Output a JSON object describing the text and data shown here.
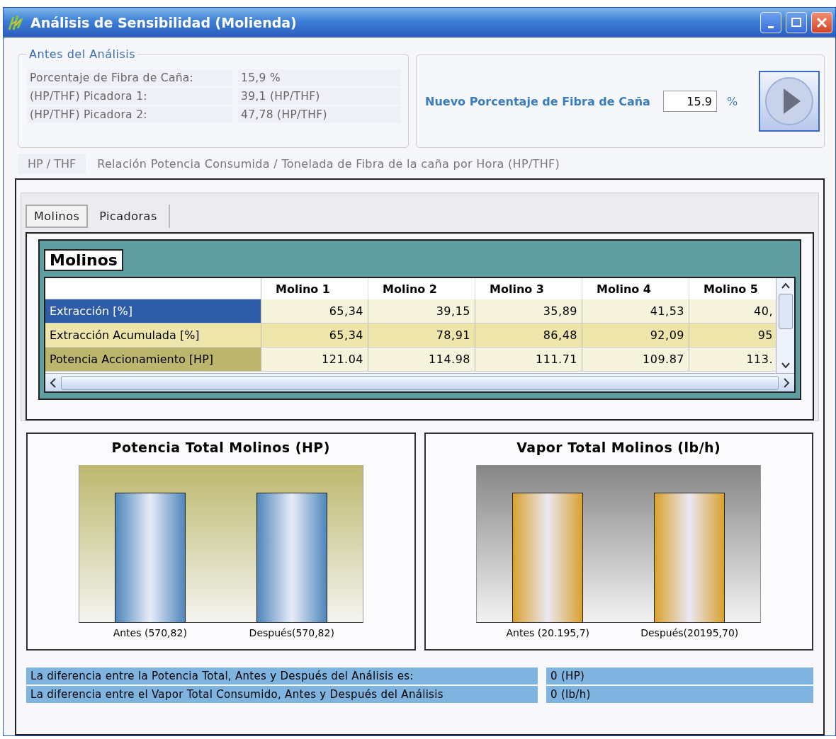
{
  "window": {
    "title": "Análisis de Sensibilidad (Molienda)"
  },
  "before": {
    "legend": "Antes del Análisis",
    "rows": [
      {
        "label": "Porcentaje de Fibra de Caña:",
        "value": "15,9 %"
      },
      {
        "label": "(HP/THF) Picadora 1:",
        "value": "39,1  (HP/THF)"
      },
      {
        "label": "(HP/THF) Picadora 2:",
        "value": "47,78  (HP/THF)"
      }
    ]
  },
  "new_fiber": {
    "label": "Nuevo Porcentaje de Fibra de Caña",
    "value": "15.9",
    "unit": "%"
  },
  "legend": {
    "abbr": "HP / THF",
    "description": "Relación Potencia Consumida / Tonelada de Fibra de la caña por Hora (HP/THF)"
  },
  "tabs": [
    {
      "label": "Molinos",
      "selected": true
    },
    {
      "label": "Picadoras",
      "selected": false
    }
  ],
  "table": {
    "title": "Molinos",
    "columns": [
      "Molino 1",
      "Molino 2",
      "Molino 3",
      "Molino 4",
      "Molino 5"
    ],
    "rows": [
      {
        "label": "Extracción [%]",
        "selected": true,
        "cells": [
          "65,34",
          "39,15",
          "35,89",
          "41,53",
          "40,"
        ]
      },
      {
        "label": "Extracción Acumulada [%]",
        "selected": false,
        "cells": [
          "65,34",
          "78,91",
          "86,48",
          "92,09",
          "95"
        ]
      },
      {
        "label": "Potencia Accionamiento [HP]",
        "selected": false,
        "cells": [
          "121.04",
          "114.98",
          "111.71",
          "109.87",
          "113."
        ]
      }
    ]
  },
  "charts": [
    {
      "title": "Potencia Total Molinos (HP)",
      "kind": "olive",
      "categories": [
        "Antes (570,82)",
        "Después(570,82)"
      ]
    },
    {
      "title": "Vapor Total Molinos (lb/h)",
      "kind": "gray",
      "categories": [
        "Antes (20.195,7)",
        "Después(20195,70)"
      ]
    }
  ],
  "differences": [
    {
      "label": "La diferencia entre la Potencia Total,  Antes y Después del Análisis es:",
      "value": "0  (HP)"
    },
    {
      "label": "La diferencia entre el Vapor Total Consumido,  Antes y Después del Análisis",
      "value": "0  (lb/h)"
    }
  ]
}
